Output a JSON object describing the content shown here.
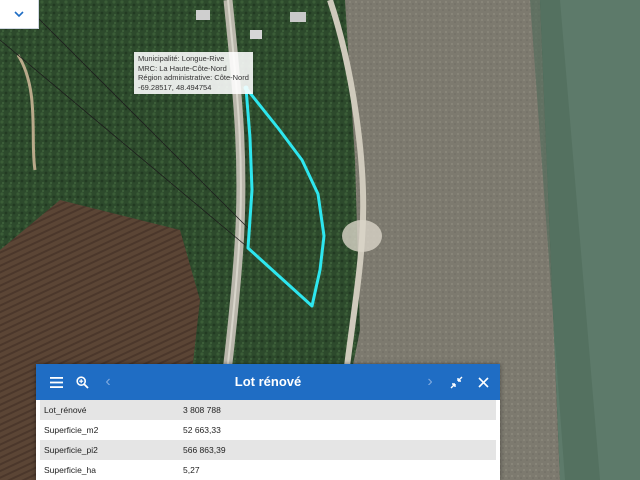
{
  "map": {
    "tooltip": {
      "municipality": "Municipalité: Longue-Rive",
      "mrc": "MRC: La Haute-Côte-Nord",
      "region": "Région administrative: Côte-Nord",
      "coordinates": "-69.28517, 48.494754"
    },
    "colors": {
      "parcel_outline": "#2ee6ee",
      "water": "#6b8573",
      "forest": "#2c4429"
    }
  },
  "collapse_button": {
    "icon": "chevron-down-icon"
  },
  "panel": {
    "title": "Lot rénové",
    "icons": [
      "menu-icon",
      "zoom-to-icon",
      "prev-arrow-icon",
      "next-arrow-icon",
      "minimize-icon",
      "close-icon"
    ],
    "accent": "#1f6dc4",
    "rows": [
      {
        "label": "Lot_rénové",
        "value": "3 808 788"
      },
      {
        "label": "Superficie_m2",
        "value": "52 663,33"
      },
      {
        "label": "Superficie_pi2",
        "value": "566 863,39"
      },
      {
        "label": "Superficie_ha",
        "value": "5,27"
      }
    ]
  }
}
